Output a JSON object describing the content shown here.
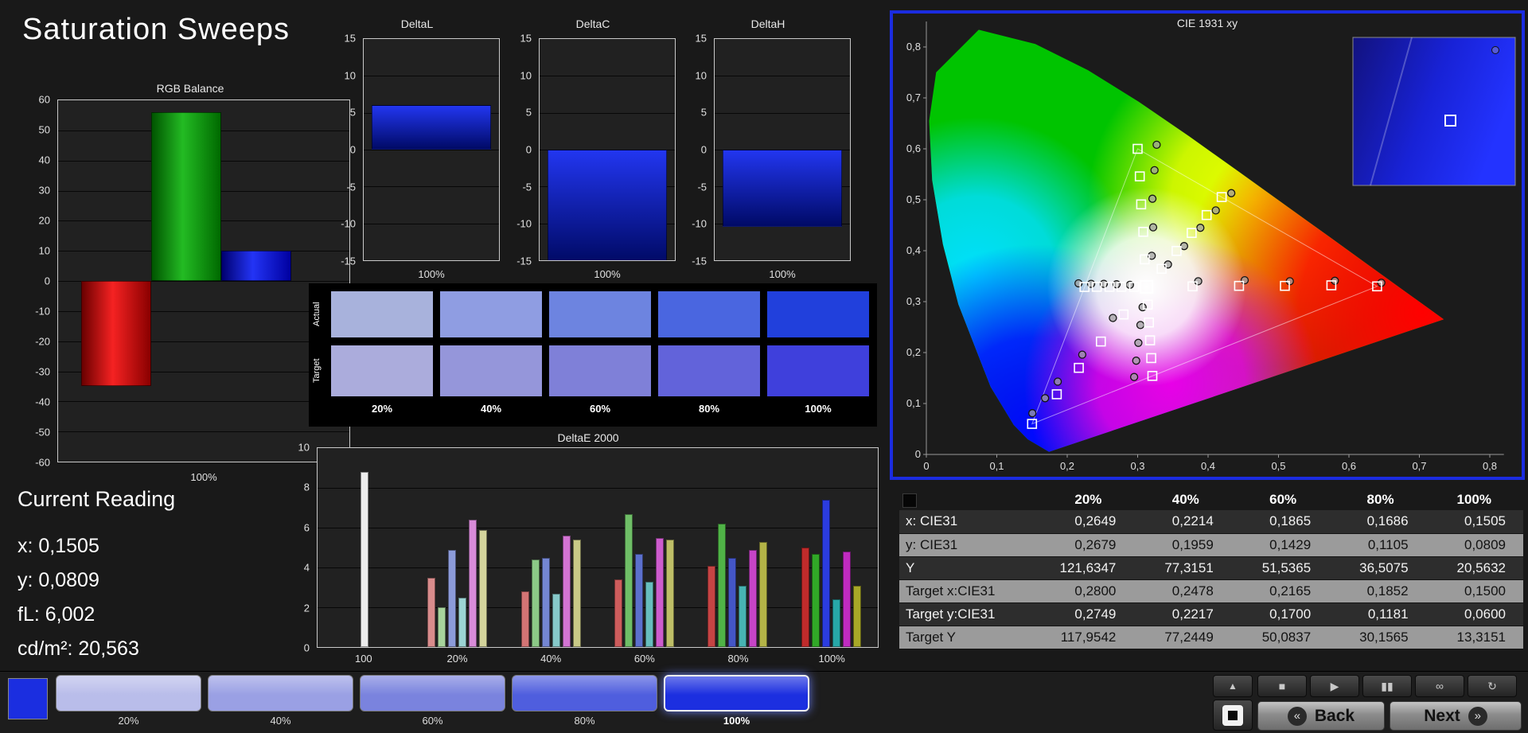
{
  "page": {
    "title": "Saturation Sweeps"
  },
  "rgb_balance": {
    "type": "bar",
    "title": "RGB Balance",
    "xlabel": "100%",
    "ymax": 60,
    "ymin": -60,
    "ystep": 10,
    "bars": [
      {
        "name": "red",
        "value": -35,
        "c1": "#6a0000",
        "c2": "#f52222",
        "c3": "#8a0000"
      },
      {
        "name": "green",
        "value": 56,
        "c1": "#005400",
        "c2": "#23bb23",
        "c3": "#006a00"
      },
      {
        "name": "blue",
        "value": 10,
        "c1": "#000070",
        "c2": "#2334f5",
        "c3": "#0000a0"
      }
    ]
  },
  "delta_charts": [
    {
      "type": "bar",
      "title": "DeltaL",
      "xlabel": "100%",
      "value": 6,
      "ymax": 15,
      "ymin": -15,
      "ystep": 5
    },
    {
      "type": "bar",
      "title": "DeltaC",
      "xlabel": "100%",
      "value": -15.3,
      "ymax": 15,
      "ymin": -15,
      "ystep": 5
    },
    {
      "type": "bar",
      "title": "DeltaH",
      "xlabel": "100%",
      "value": -10.5,
      "ymax": 15,
      "ymin": -15,
      "ystep": 5
    }
  ],
  "delta_bar_colors": {
    "top": "#2236f0",
    "bottom": "#000a66"
  },
  "swatch_compare": {
    "row_labels": [
      "Actual",
      "Target"
    ],
    "col_labels": [
      "20%",
      "40%",
      "60%",
      "80%",
      "100%"
    ],
    "actual_colors": [
      "#a8b2dc",
      "#8f9de2",
      "#6d84e0",
      "#4a66e0",
      "#2140dc"
    ],
    "target_colors": [
      "#abacdc",
      "#9596da",
      "#7f80d8",
      "#6263da",
      "#3f40dc"
    ]
  },
  "deltae": {
    "type": "bar",
    "title": "DeltaE 2000",
    "ymax": 10,
    "ymin": 0,
    "ystep": 2,
    "groups": [
      {
        "label": "100",
        "bars": [
          {
            "v": 8.8,
            "c": "#ededed"
          }
        ]
      },
      {
        "label": "20%",
        "bars": [
          {
            "v": 3.5,
            "c": "#d98c8c"
          },
          {
            "v": 2.0,
            "c": "#a7d49c"
          },
          {
            "v": 4.9,
            "c": "#8c9bd9"
          },
          {
            "v": 2.5,
            "c": "#9cd4d4"
          },
          {
            "v": 6.4,
            "c": "#d98cd9"
          },
          {
            "v": 5.9,
            "c": "#d4d49c"
          }
        ]
      },
      {
        "label": "40%",
        "bars": [
          {
            "v": 2.8,
            "c": "#d37474"
          },
          {
            "v": 4.4,
            "c": "#8cc987"
          },
          {
            "v": 4.5,
            "c": "#7486d3"
          },
          {
            "v": 2.7,
            "c": "#87c9c9"
          },
          {
            "v": 5.6,
            "c": "#d374d3"
          },
          {
            "v": 5.4,
            "c": "#c9c987"
          }
        ]
      },
      {
        "label": "60%",
        "bars": [
          {
            "v": 3.4,
            "c": "#cd5c5c"
          },
          {
            "v": 6.7,
            "c": "#6fbe67"
          },
          {
            "v": 4.7,
            "c": "#5c70cd"
          },
          {
            "v": 3.3,
            "c": "#67bebe"
          },
          {
            "v": 5.5,
            "c": "#cd5ccd"
          },
          {
            "v": 5.4,
            "c": "#bebe67"
          }
        ]
      },
      {
        "label": "80%",
        "bars": [
          {
            "v": 4.1,
            "c": "#c64444"
          },
          {
            "v": 6.2,
            "c": "#50b347"
          },
          {
            "v": 4.5,
            "c": "#4456c6"
          },
          {
            "v": 3.1,
            "c": "#47b3b3"
          },
          {
            "v": 4.9,
            "c": "#c644c6"
          },
          {
            "v": 5.3,
            "c": "#b3b347"
          }
        ]
      },
      {
        "label": "100%",
        "bars": [
          {
            "v": 5.0,
            "c": "#c02b2b"
          },
          {
            "v": 4.7,
            "c": "#31a827"
          },
          {
            "v": 7.4,
            "c": "#2b3ce0"
          },
          {
            "v": 2.4,
            "c": "#27a8a8"
          },
          {
            "v": 4.8,
            "c": "#c02bc0"
          },
          {
            "v": 3.1,
            "c": "#a8a827"
          }
        ]
      }
    ]
  },
  "current_reading": {
    "title": "Current Reading",
    "lines": [
      "x: 0,1505",
      "y: 0,0809",
      "fL: 6,002",
      "cd/m²: 20,563"
    ]
  },
  "cie": {
    "type": "scatter",
    "title": "CIE 1931 xy",
    "xticks": [
      "0",
      "0,1",
      "0,2",
      "0,3",
      "0,4",
      "0,5",
      "0,6",
      "0,7",
      "0,8"
    ],
    "yticks": [
      "0",
      "0,1",
      "0,2",
      "0,3",
      "0,4",
      "0,5",
      "0,6",
      "0,7",
      "0,8"
    ],
    "triangle": [
      [
        0.64,
        0.33
      ],
      [
        0.3,
        0.6
      ],
      [
        0.15,
        0.06
      ]
    ],
    "white_point": [
      0.3127,
      0.329
    ],
    "targets": [
      [
        0.378,
        0.33
      ],
      [
        0.444,
        0.331
      ],
      [
        0.509,
        0.331
      ],
      [
        0.575,
        0.332
      ],
      [
        0.64,
        0.33
      ],
      [
        0.31,
        0.383
      ],
      [
        0.308,
        0.437
      ],
      [
        0.305,
        0.491
      ],
      [
        0.303,
        0.546
      ],
      [
        0.3,
        0.6
      ],
      [
        0.28,
        0.2749
      ],
      [
        0.2478,
        0.2217
      ],
      [
        0.2165,
        0.17
      ],
      [
        0.1852,
        0.1181
      ],
      [
        0.15,
        0.06
      ],
      [
        0.295,
        0.329
      ],
      [
        0.277,
        0.329
      ],
      [
        0.26,
        0.329
      ],
      [
        0.242,
        0.329
      ],
      [
        0.2246,
        0.3287
      ],
      [
        0.3143,
        0.294
      ],
      [
        0.316,
        0.2591
      ],
      [
        0.3176,
        0.2241
      ],
      [
        0.3193,
        0.1892
      ],
      [
        0.3209,
        0.1542
      ],
      [
        0.334,
        0.3643
      ],
      [
        0.3553,
        0.3995
      ],
      [
        0.3767,
        0.4348
      ],
      [
        0.398,
        0.47
      ],
      [
        0.4193,
        0.5053
      ]
    ],
    "measured": [
      [
        0.386,
        0.34
      ],
      [
        0.452,
        0.342
      ],
      [
        0.516,
        0.34
      ],
      [
        0.58,
        0.341
      ],
      [
        0.646,
        0.337
      ],
      [
        0.32,
        0.39
      ],
      [
        0.322,
        0.446
      ],
      [
        0.321,
        0.502
      ],
      [
        0.324,
        0.558
      ],
      [
        0.327,
        0.608
      ],
      [
        0.2649,
        0.2679
      ],
      [
        0.2214,
        0.1959
      ],
      [
        0.1865,
        0.1429
      ],
      [
        0.1686,
        0.1105
      ],
      [
        0.1505,
        0.0809
      ],
      [
        0.289,
        0.333
      ],
      [
        0.27,
        0.334
      ],
      [
        0.252,
        0.335
      ],
      [
        0.234,
        0.335
      ],
      [
        0.216,
        0.336
      ],
      [
        0.307,
        0.289
      ],
      [
        0.304,
        0.254
      ],
      [
        0.301,
        0.219
      ],
      [
        0.298,
        0.184
      ],
      [
        0.295,
        0.152
      ],
      [
        0.343,
        0.373
      ],
      [
        0.366,
        0.409
      ],
      [
        0.389,
        0.445
      ],
      [
        0.411,
        0.479
      ],
      [
        0.433,
        0.513
      ]
    ]
  },
  "table": {
    "columns": [
      "20%",
      "40%",
      "60%",
      "80%",
      "100%"
    ],
    "rows": [
      {
        "label": "x: CIE31",
        "values": [
          "0,2649",
          "0,2214",
          "0,1865",
          "0,1686",
          "0,1505"
        ],
        "light": false
      },
      {
        "label": "y: CIE31",
        "values": [
          "0,2679",
          "0,1959",
          "0,1429",
          "0,1105",
          "0,0809"
        ],
        "light": true
      },
      {
        "label": "Y",
        "values": [
          "121,6347",
          "77,3151",
          "51,5365",
          "36,5075",
          "20,5632"
        ],
        "light": false
      },
      {
        "label": "Target x:CIE31",
        "values": [
          "0,2800",
          "0,2478",
          "0,2165",
          "0,1852",
          "0,1500"
        ],
        "light": true
      },
      {
        "label": "Target y:CIE31",
        "values": [
          "0,2749",
          "0,2217",
          "0,1700",
          "0,1181",
          "0,0600"
        ],
        "light": false
      },
      {
        "label": "Target Y",
        "values": [
          "117,9542",
          "77,2449",
          "50,0837",
          "30,1565",
          "13,3151"
        ],
        "light": true
      }
    ]
  },
  "bottom_bar": {
    "patch_color": "#1b2ee0",
    "swatches": [
      {
        "label": "20%",
        "color": "#b9bdea",
        "selected": false
      },
      {
        "label": "40%",
        "color": "#9aa0e4",
        "selected": false
      },
      {
        "label": "60%",
        "color": "#7a83de",
        "selected": false
      },
      {
        "label": "80%",
        "color": "#4f5ede",
        "selected": false
      },
      {
        "label": "100%",
        "color": "#1c2fe0",
        "selected": true
      }
    ],
    "up_glyph": "▲",
    "icon_buttons": [
      {
        "name": "stop-icon",
        "glyph": "■"
      },
      {
        "name": "play-icon",
        "glyph": "▶"
      },
      {
        "name": "pause-icon",
        "glyph": "▮▮"
      },
      {
        "name": "loop-icon",
        "glyph": "∞"
      },
      {
        "name": "refresh-icon",
        "glyph": "↻"
      }
    ],
    "back_label": "Back",
    "next_label": "Next",
    "back_arrows": "«",
    "next_arrows": "»"
  }
}
